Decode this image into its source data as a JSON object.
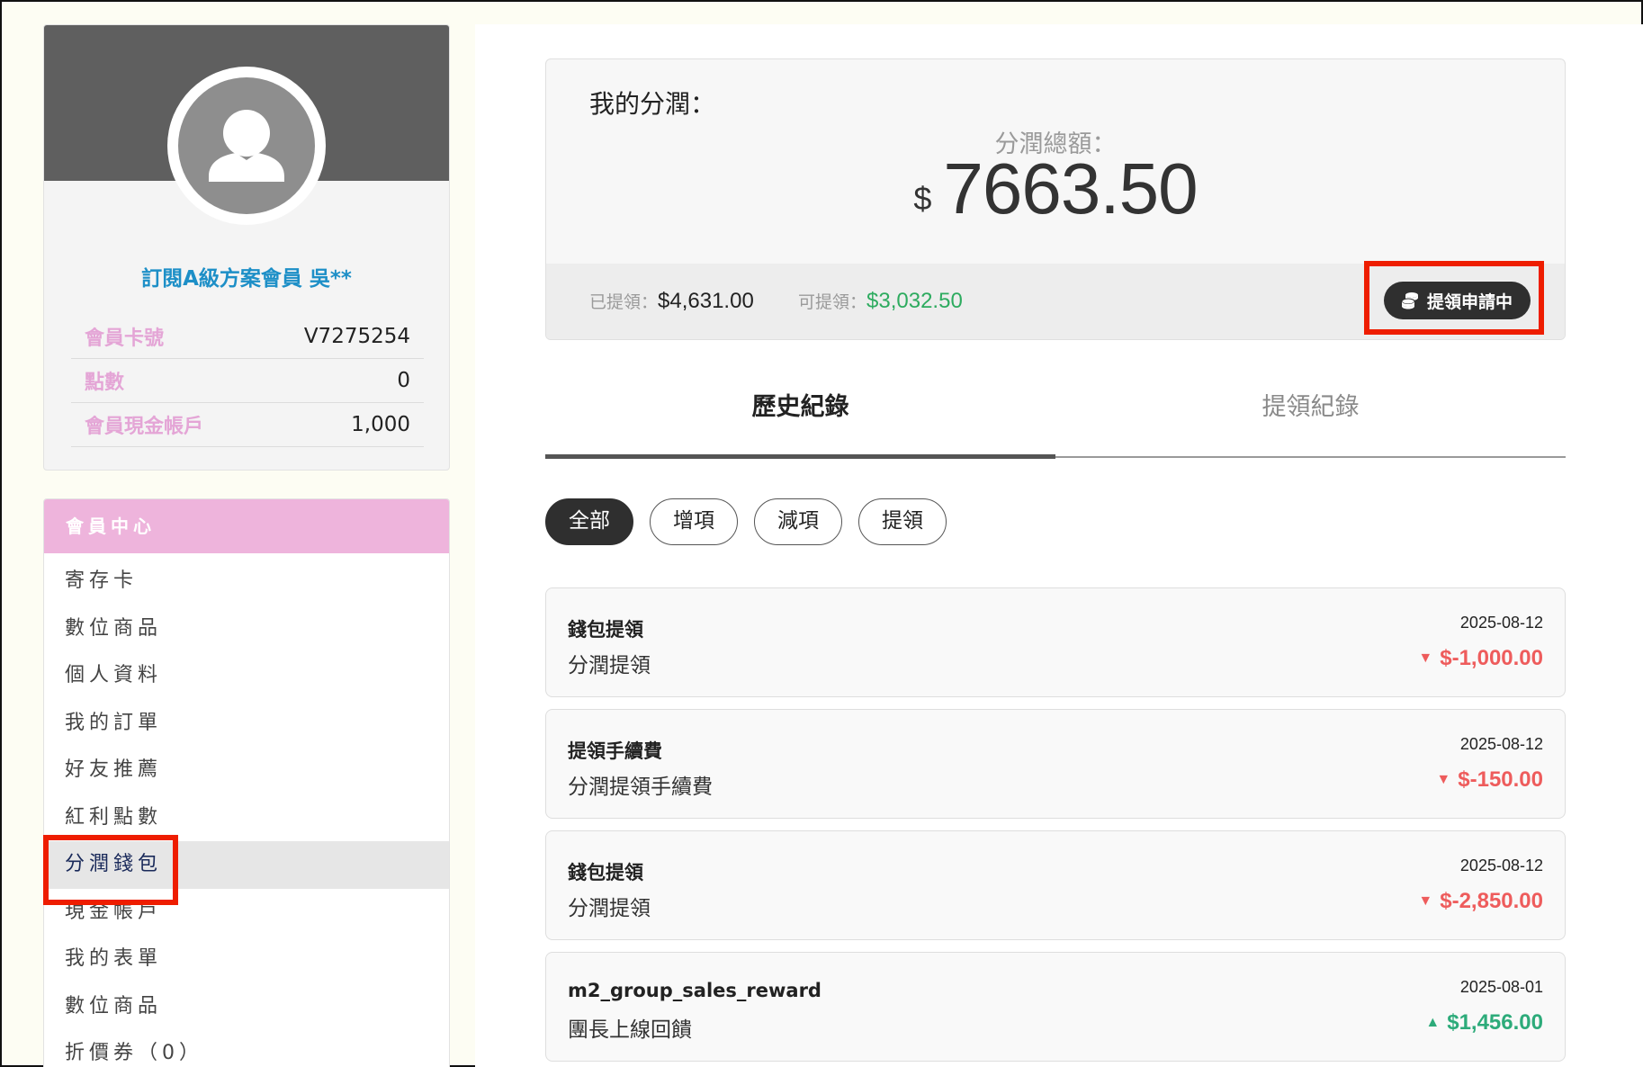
{
  "profile": {
    "member_name": "訂閱A級方案會員 吳**",
    "fields": [
      {
        "label": "會員卡號",
        "value": "V7275254"
      },
      {
        "label": "點數",
        "value": "0"
      },
      {
        "label": "會員現金帳戶",
        "value": "1,000"
      }
    ]
  },
  "menu": {
    "header": "會員中心",
    "items": [
      {
        "label": "寄存卡"
      },
      {
        "label": "數位商品"
      },
      {
        "label": "個人資料"
      },
      {
        "label": "我的訂單"
      },
      {
        "label": "好友推薦"
      },
      {
        "label": "紅利點數"
      },
      {
        "label": "分潤錢包"
      },
      {
        "label": "現金帳戶"
      },
      {
        "label": "我的表單"
      },
      {
        "label": "數位商品"
      },
      {
        "label": "折價券（0）"
      }
    ],
    "active_index": 6
  },
  "summary": {
    "title": "我的分潤：",
    "total_label": "分潤總額：",
    "currency": "$",
    "total_amount": "7663.50",
    "withdrawn_label": "已提領：",
    "withdrawn_amount": "$4,631.00",
    "available_label": "可提領：",
    "available_amount": "$3,032.50",
    "withdraw_button": "提領申請中"
  },
  "tabs": [
    {
      "label": "歷史紀錄",
      "active": true
    },
    {
      "label": "提領紀錄",
      "active": false
    }
  ],
  "filters": [
    {
      "label": "全部",
      "active": true
    },
    {
      "label": "增項",
      "active": false
    },
    {
      "label": "減項",
      "active": false
    },
    {
      "label": "提領",
      "active": false
    }
  ],
  "records": [
    {
      "title": "錢包提領",
      "desc": "分潤提領",
      "date": "2025-08-12",
      "amount": "$-1,000.00",
      "direction": "down"
    },
    {
      "title": "提領手續費",
      "desc": "分潤提領手續費",
      "date": "2025-08-12",
      "amount": "$-150.00",
      "direction": "down"
    },
    {
      "title": "錢包提領",
      "desc": "分潤提領",
      "date": "2025-08-12",
      "amount": "$-2,850.00",
      "direction": "down"
    },
    {
      "title": "m2_group_sales_reward",
      "desc": "團長上線回饋",
      "date": "2025-08-01",
      "amount": "$1,456.00",
      "direction": "up"
    }
  ],
  "colors": {
    "accent_pink": "#eeb4dc",
    "name_blue": "#1d8fc7",
    "positive_green": "#2dab5f",
    "negative_red": "#ee5c5c",
    "highlight_red": "#ee1d00"
  },
  "icons": {
    "avatar": "user-silhouette-icon",
    "withdraw": "coins-icon",
    "down_arrow": "caret-down-icon",
    "up_arrow": "caret-up-icon"
  }
}
